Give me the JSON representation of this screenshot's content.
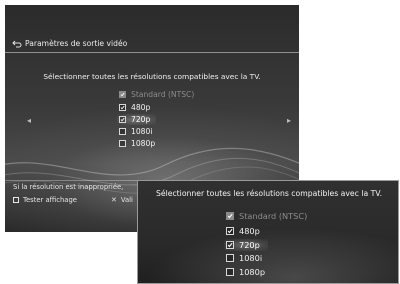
{
  "header": {
    "title": "Paramètres de sortie vidéo"
  },
  "instruction": "Sélectionner toutes les résolutions compatibles avec la TV.",
  "nav": {
    "left": "◂",
    "right": "▸"
  },
  "options": [
    {
      "label": "Standard (NTSC)",
      "checked": true,
      "disabled": true,
      "selected": false
    },
    {
      "label": "480p",
      "checked": true,
      "disabled": false,
      "selected": false
    },
    {
      "label": "720p",
      "checked": true,
      "disabled": false,
      "selected": true
    },
    {
      "label": "1080i",
      "checked": false,
      "disabled": false,
      "selected": false
    },
    {
      "label": "1080p",
      "checked": false,
      "disabled": false,
      "selected": false
    }
  ],
  "footer": {
    "note": "Si la résolution est inappropriée,",
    "test_label": "Tester affichage",
    "validate_label": "Vali"
  },
  "zoom": {
    "instruction": "Sélectionner toutes les résolutions compatibles avec la TV."
  }
}
